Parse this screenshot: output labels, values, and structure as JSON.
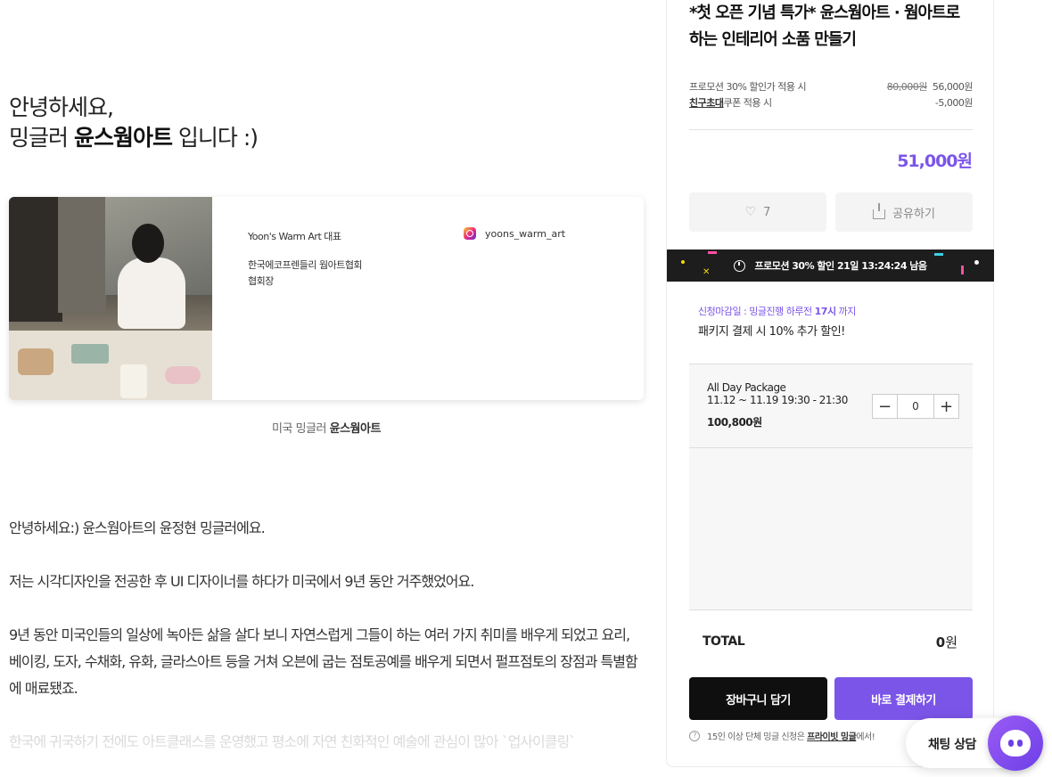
{
  "article": {
    "greeting_line1": "안녕하세요,",
    "greeting_line2_pre": "밍글러 ",
    "greeting_line2_bold": "윤스웜아트",
    "greeting_line2_post": " 입니다 :)",
    "profile": {
      "role": "Yoon's Warm Art 대표",
      "association_line1": "한국에코프렌들리 웜아트협회",
      "association_line2": "협회장",
      "instagram": "yoons_warm_art"
    },
    "caption_pre": "미국 밍글러 ",
    "caption_bold": "윤스웜아트",
    "paragraphs": [
      "안녕하세요:) 윤스웜아트의 윤정현 밍글러에요.",
      "저는 시각디자인을 전공한 후 UI 디자이너를 하다가 미국에서 9년 동안 거주했었어요.",
      "9년 동안 미국인들의 일상에 녹아든 삶을 살다 보니 자연스럽게 그들이 하는 여러 가지 취미를 배우게 되었고 요리, 베이킹, 도자, 수채화, 유화, 글라스아트 등을 거쳐 오븐에 굽는 점토공예를 배우게 되면서 펄프점토의 장점과 특별함에 매료됐죠.",
      "한국에 귀국하기 전에도 아트클래스를 운영했고 평소에 자연 친화적인 예술에 관심이 많아 `업사이클링`"
    ]
  },
  "panel": {
    "title": "*첫 오픈 기념 특가* 윤스웜아트 · 웜아트로 하는 인테리어 소품 만들기",
    "promo_discount_label": "프로모션 30% 할인가 적용 시",
    "original_price": "80,000원",
    "promo_price": "56,000원",
    "coupon_link": "친구초대",
    "coupon_label": "쿠폰 적용 시",
    "coupon_discount": "-5,000원",
    "final_price": "51,000원",
    "like_count": "7",
    "share_label": "공유하기",
    "promo_banner": "프로모션 30% 할인 21일 13:24:24 남음",
    "deadline_pre": "신청마감일 : 밍글진행 하루전 ",
    "deadline_bold": "17시",
    "deadline_post": " 까지",
    "package_note": "패키지 결제 시 10% 추가 할인!",
    "option": {
      "name": "All Day Package",
      "date": "11.12 ~ 11.19 19:30 - 21:30",
      "price": "100,800원",
      "quantity": "0"
    },
    "total_label": "TOTAL",
    "total_value": "0",
    "total_unit": "원",
    "cart_button": "장바구니 담기",
    "buy_button": "바로 결제하기",
    "help_pre": "15인 이상 단체 밍글 신청은 ",
    "help_link": "프라이빗 밍글",
    "help_post": "에서!"
  },
  "chat": {
    "label": "채팅 상담"
  },
  "colors": {
    "accent": "#7b55e8",
    "dark": "#0f0f0f",
    "promo_bar": "#1d1d1d"
  },
  "icons": {
    "like": "heart-icon",
    "share": "share-icon",
    "timer": "clock-icon",
    "help": "question-icon",
    "instagram": "instagram-icon",
    "chat": "chat-bot-icon"
  }
}
